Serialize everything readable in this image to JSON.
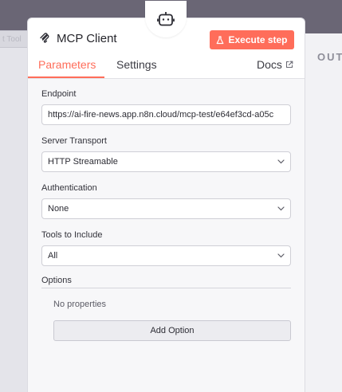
{
  "background": {
    "left_tab_label": "t Tool",
    "output_label": "OUT"
  },
  "node": {
    "title": "MCP Client",
    "badge_icon": "robot-icon",
    "title_icon": "mcp-logo-icon"
  },
  "header": {
    "execute_label": "Execute step",
    "execute_icon": "flask-icon",
    "tabs": [
      {
        "label": "Parameters",
        "active": true
      },
      {
        "label": "Settings",
        "active": false
      }
    ],
    "docs_label": "Docs",
    "docs_icon": "external-link-icon"
  },
  "fields": {
    "endpoint": {
      "label": "Endpoint",
      "value": "https://ai-fire-news.app.n8n.cloud/mcp-test/e64ef3cd-a05c"
    },
    "server_transport": {
      "label": "Server Transport",
      "value": "HTTP Streamable"
    },
    "authentication": {
      "label": "Authentication",
      "value": "None"
    },
    "tools_to_include": {
      "label": "Tools to Include",
      "value": "All"
    }
  },
  "options": {
    "label": "Options",
    "empty_text": "No properties",
    "add_label": "Add Option"
  },
  "colors": {
    "accent": "#ff6d5a",
    "topbar": "#6a6675"
  }
}
